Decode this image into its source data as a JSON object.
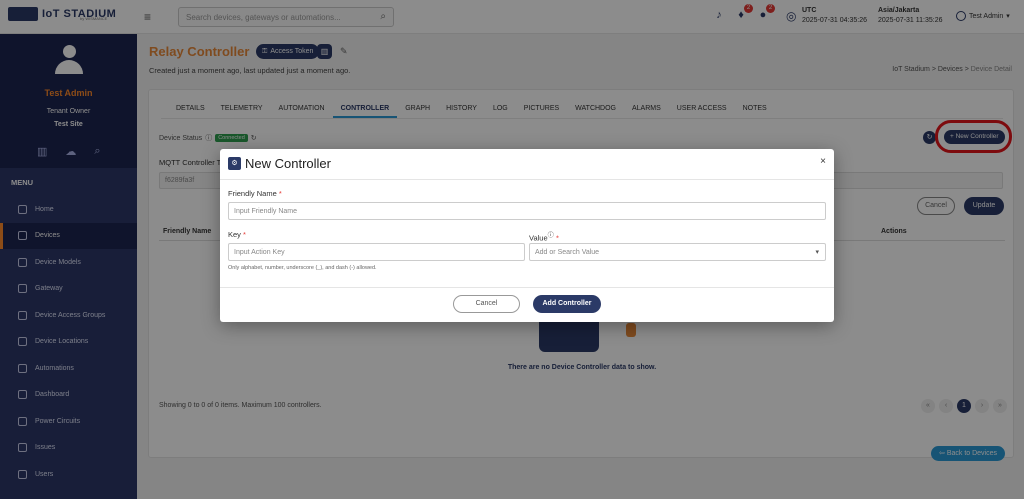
{
  "topbar": {
    "logo_text": "IoT STADIUM",
    "logo_sub": "by WISMANCE",
    "search_placeholder": "Search devices, gateways or automations...",
    "notif_badges": [
      "2",
      "2"
    ],
    "tz1_label": "UTC",
    "tz1_time": "2025-07-31 04:35:26",
    "tz2_label": "Asia/Jakarta",
    "tz2_time": "2025-07-31 11:35:26",
    "user": "Test Admin"
  },
  "sidebar": {
    "name": "Test Admin",
    "role": "Tenant Owner",
    "site": "Test Site",
    "menu_label": "MENU",
    "items": [
      {
        "label": "Home"
      },
      {
        "label": "Devices"
      },
      {
        "label": "Device Models"
      },
      {
        "label": "Gateway"
      },
      {
        "label": "Device Access Groups"
      },
      {
        "label": "Device Locations"
      },
      {
        "label": "Automations"
      },
      {
        "label": "Dashboard"
      },
      {
        "label": "Power Circuits"
      },
      {
        "label": "Issues"
      },
      {
        "label": "Users"
      }
    ]
  },
  "page": {
    "title": "Relay Controller",
    "access_token": "Access Token",
    "subtitle": "Created just a moment ago, last updated just a moment ago.",
    "breadcrumb": [
      "IoT Stadium",
      "Devices",
      "Device Detail"
    ],
    "tabs": [
      "DETAILS",
      "TELEMETRY",
      "AUTOMATION",
      "CONTROLLER",
      "GRAPH",
      "HISTORY",
      "LOG",
      "PICTURES",
      "WATCHDOG",
      "ALARMS",
      "USER ACCESS",
      "NOTES"
    ],
    "active_tab": "CONTROLLER",
    "device_status_label": "Device Status",
    "status": "Connected",
    "new_controller": "+ New Controller",
    "mqtt_label": "MQTT Controller T",
    "mqtt_value": "f6289fa3f",
    "cancel": "Cancel",
    "update": "Update",
    "table_headers": [
      "Friendly Name",
      "Actions"
    ],
    "empty_text": "There are no Device Controller data to show.",
    "showing": "Showing 0 to 0 of 0 items. Maximum 100 controllers.",
    "pager": [
      "«",
      "‹",
      "1",
      "›",
      "»"
    ],
    "back": "Back to Devices"
  },
  "modal": {
    "title": "New Controller",
    "close": "×",
    "friendly_label": "Friendly Name",
    "friendly_placeholder": "Input Friendly Name",
    "key_label": "Key",
    "key_placeholder": "Input Action Key",
    "value_label": "Value",
    "value_placeholder": "Add or Search Value",
    "hint": "Only alphabet, number, underscore (_), and dash (-) allowed.",
    "cancel": "Cancel",
    "add": "Add Controller"
  },
  "colors": {
    "brand_navy": "#2b3a67",
    "accent_orange": "#e8893a",
    "highlight_red": "#e3141b",
    "connected_green": "#2e9e4f"
  }
}
